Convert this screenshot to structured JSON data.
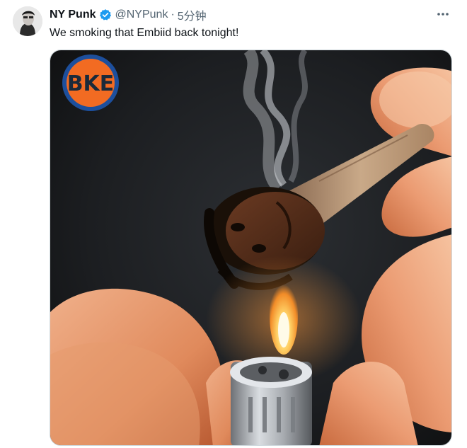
{
  "tweet": {
    "display_name": "NY Punk",
    "handle": "@NYPunk",
    "separator": "·",
    "timestamp": "5分钟",
    "text": "We smoking that Embiid back tonight!",
    "verified": true
  },
  "media": {
    "logo_text": "BKE",
    "logo_colors": {
      "ring": "#1d4f9c",
      "fill": "#f26b22",
      "text": "#1b2a3a"
    }
  },
  "icons": {
    "verified": "verified-badge-icon",
    "more": "more-options-icon"
  },
  "colors": {
    "accent": "#1d9bf0",
    "secondary_text": "#536471"
  }
}
